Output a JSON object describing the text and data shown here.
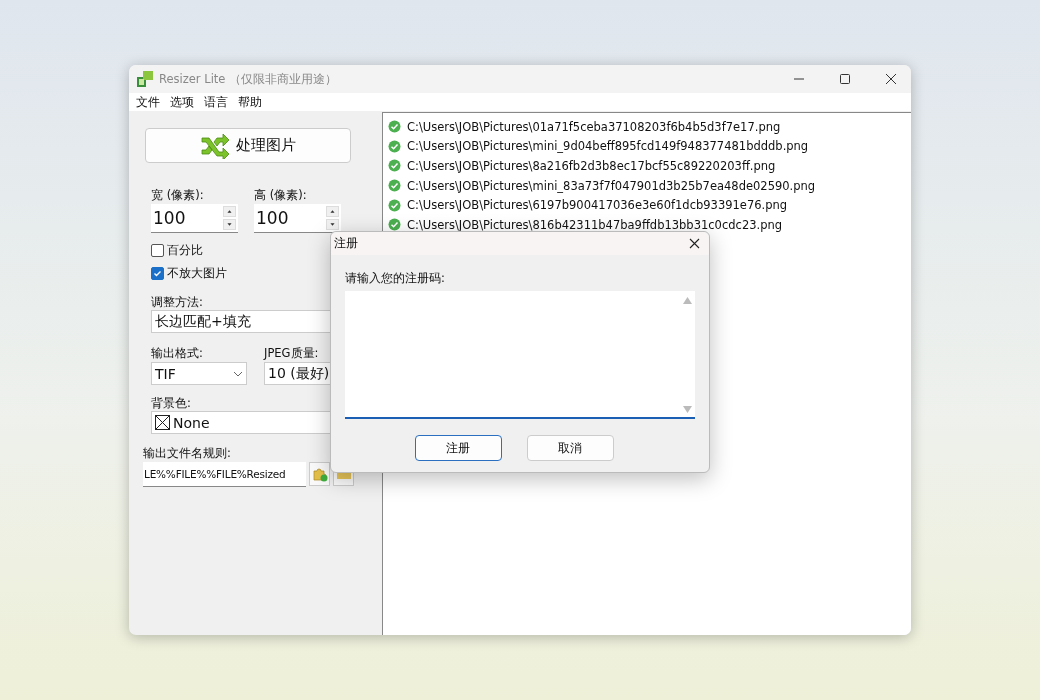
{
  "window": {
    "title": "Resizer Lite （仅限非商业用途）"
  },
  "menu": [
    "文件",
    "选项",
    "语言",
    "帮助"
  ],
  "process_button": {
    "label": "处理图片"
  },
  "size_fields": [
    {
      "label": "宽 (像素):",
      "value": "100"
    },
    {
      "label": "高 (像素):",
      "value": "100"
    }
  ],
  "checkboxes": [
    {
      "label": "百分比",
      "checked": false
    },
    {
      "label": "不放大图片",
      "checked": true
    }
  ],
  "resize_method": {
    "label": "调整方法:",
    "value": "长边匹配+填充"
  },
  "output_format": {
    "label": "输出格式:",
    "value": "TIF"
  },
  "jpeg_quality": {
    "label": "JPEG质量:",
    "value": "10 (最好)"
  },
  "background_color": {
    "label": "背景色:",
    "value": "None"
  },
  "filename_rule": {
    "label": "输出文件名规则:",
    "value": "LE%%FILE%%FILE%Resized"
  },
  "files": [
    {
      "path": "C:\\Users\\JOB\\Pictures\\01a71f5ceba37108203f6b4b5d3f7e17.png"
    },
    {
      "path": "C:\\Users\\JOB\\Pictures\\mini_9d04beff895fcd149f948377481bdddb.png"
    },
    {
      "path": "C:\\Users\\JOB\\Pictures\\8a216fb2d3b8ec17bcf55c89220203ff.png"
    },
    {
      "path": "C:\\Users\\JOB\\Pictures\\mini_83a73f7f047901d3b25b7ea48de02590.png"
    },
    {
      "path": "C:\\Users\\JOB\\Pictures\\6197b900417036e3e60f1dcb93391e76.png"
    },
    {
      "path": "C:\\Users\\JOB\\Pictures\\816b42311b47ba9ffdb13bb31c0cdc23.png"
    }
  ],
  "dialog": {
    "title": "注册",
    "prompt": "请输入您的注册码:",
    "buttons": [
      {
        "label": "注册",
        "focused": true
      },
      {
        "label": "取消",
        "focused": false
      }
    ]
  }
}
